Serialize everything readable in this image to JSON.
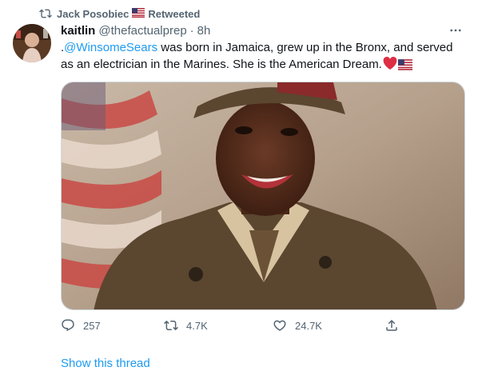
{
  "social_context": {
    "retweeter": "Jack Posobiec",
    "label": "Retweeted"
  },
  "tweet": {
    "author_name": "kaitlin",
    "author_handle": "@thefactualprep",
    "separator": "·",
    "time": "8h",
    "text_prefix": ".",
    "mention": "@WinsomeSears",
    "text_body": " was born in Jamaica, grew up in the Bronx, and served as an electrician in the Marines. She is the American Dream."
  },
  "actions": {
    "replies": "257",
    "retweets": "4.7K",
    "likes": "24.7K"
  },
  "show_thread": "Show this thread",
  "colors": {
    "accent": "#1d9bf0",
    "secondary_text": "#536471",
    "primary_text": "#0f1419",
    "heart": "#e0245e"
  },
  "icons": [
    "retweet-icon",
    "us-flag-icon",
    "more-icon",
    "heart-emoji-icon",
    "reply-icon",
    "retweet-icon",
    "like-icon",
    "share-icon"
  ]
}
